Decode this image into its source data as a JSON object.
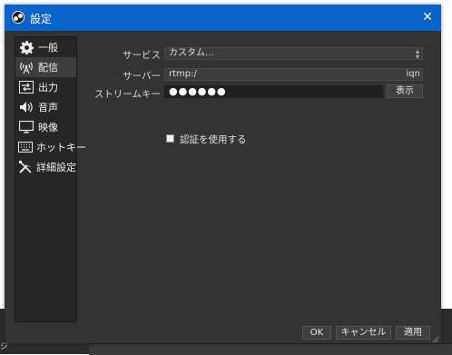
{
  "window": {
    "title": "設定",
    "close_glyph": "✕"
  },
  "sidebar": {
    "items": [
      {
        "label": "一般",
        "icon": "gear-icon"
      },
      {
        "label": "配信",
        "icon": "broadcast-icon"
      },
      {
        "label": "出力",
        "icon": "output-icon"
      },
      {
        "label": "音声",
        "icon": "speaker-icon"
      },
      {
        "label": "映像",
        "icon": "monitor-icon"
      },
      {
        "label": "ホットキー",
        "icon": "keyboard-icon"
      },
      {
        "label": "詳細設定",
        "icon": "tools-icon"
      }
    ],
    "active_index": 1
  },
  "form": {
    "service_label": "サービス",
    "service_value": "カスタム...",
    "server_label": "サーバー",
    "server_value": "rtmp:/",
    "server_tail": "iqn",
    "stream_key_label": "ストリームキー",
    "stream_key_value": "●●●●●●",
    "show_button": "表示",
    "auth_label": "認証を使用する"
  },
  "footer": {
    "ok": "OK",
    "cancel": "キャンセル",
    "apply": "適用"
  },
  "colors": {
    "titlebar": "#0a63c9",
    "dialog_bg": "#333333",
    "sidebar_bg": "#262626"
  }
}
